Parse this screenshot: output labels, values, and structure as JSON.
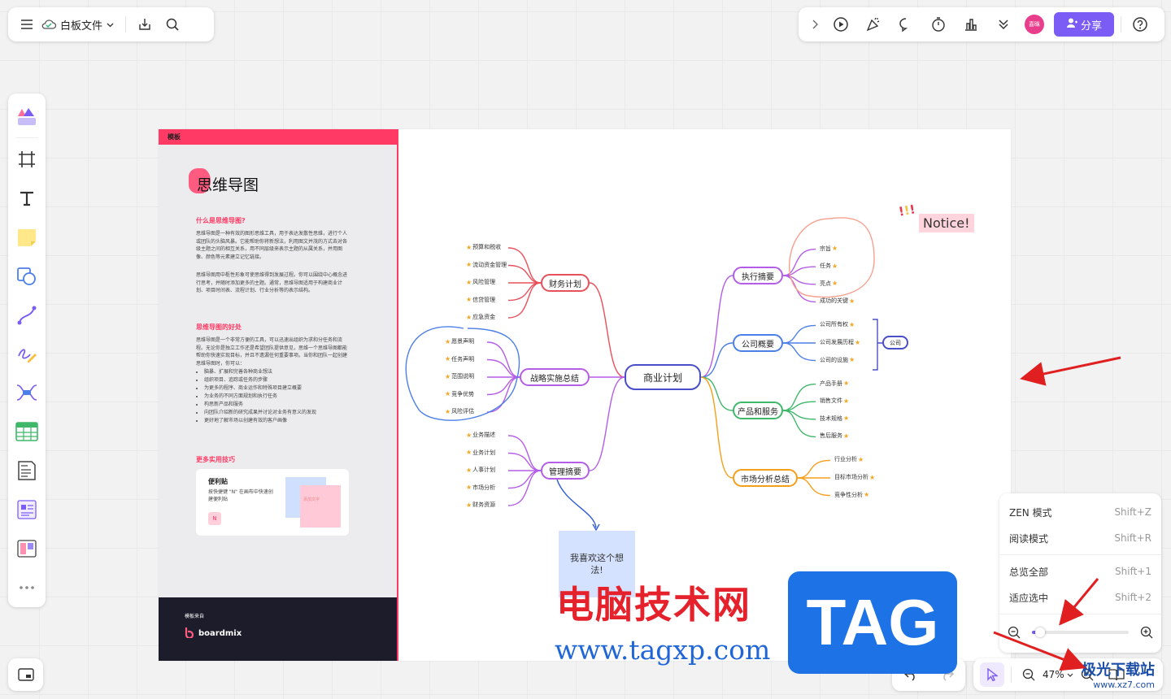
{
  "toolbar": {
    "doc_title": "白板文件",
    "avatar_label": "喜眯",
    "share_label": "分享"
  },
  "board": {
    "template_tag": "模板",
    "title": "思维导图",
    "section1_heading": "什么是思维导图?",
    "section1_text": "思维导图是一种有效的图形思维工具，用于表达发散性思维，进行个人或团队的头脑风暴。它能帮助你将新想法，利用图文并茂的方式去对各级主题之间的相互关系，用不同层级来表示主题的从属关系，并用图像、颜色等元素建立记忆链接。",
    "section1_text2": "思维导图用中枢性形象可使思维得到发展过程。你可以围绕中心概念进行思考，并随时添加更多的主题。通常，思维导图适用于构建商业计划、项目时间表、流程计划、行业分析等的表示结构。",
    "section2_heading": "思维导图的好处",
    "section2_text": "思维导图是一个非常方便的工具，可以迅速出组织为求和分任务和流程。无论你是独立工作还是希望团队提供意见，思维一个思维导图都能帮助你快速实现目标，并且不遗漏任何重要事项。当你和团队一起创建思维导图时，你可以：",
    "section2_bullets": [
      "脑暴、扩展和完善各种商业想法",
      "组织项目、追踪或任务的步骤",
      "为更多的程序、商业运作和特殊项目建立概要",
      "为业务的不同方面规划和执行任务",
      "构思新产品和服务",
      "向团队介绍新的研究成果并讨论对业务有意义的发现",
      "更好地了解市场以创建有效的客户画像"
    ],
    "section3_heading": "更多实用技巧",
    "tip_title": "便利贴",
    "tip_text": "按快捷键 \"N\" 在画布中快速创建便利贴",
    "tip_key": "N",
    "tip_note": "添加文字",
    "footer_from": "模板来自",
    "footer_brand": "boardmix",
    "center_node": "商业计划",
    "left_branches": [
      {
        "label": "财务计划",
        "leaves": [
          "预算和税收",
          "流动资金管理",
          "风险管理",
          "信贷管理",
          "应急资金"
        ]
      },
      {
        "label": "战略实施总结",
        "leaves": [
          "愿景声明",
          "任务声明",
          "范围说明",
          "竞争优势",
          "风险评估"
        ]
      },
      {
        "label": "管理摘要",
        "leaves": [
          "业务描述",
          "业务计划",
          "人事计划",
          "市场分析",
          "财务资源"
        ]
      }
    ],
    "right_branches": [
      {
        "label": "执行摘要",
        "leaves": [
          "宗旨",
          "任务",
          "亮点",
          "成功的关键"
        ]
      },
      {
        "label": "公司概要",
        "leaves": [
          "公司所有权",
          "公司发展历程",
          "公司的设施"
        ]
      },
      {
        "label": "产品和服务",
        "leaves": [
          "产品手册",
          "销售文件",
          "技术规格",
          "售后服务"
        ]
      },
      {
        "label": "市场分析总结",
        "leaves": [
          "行业分析",
          "目标市场分析",
          "竞争性分析"
        ]
      }
    ],
    "bracket_label": "公司",
    "sticky_text": "我喜欢这个想法!",
    "notice_text": "Notice!"
  },
  "view_menu": {
    "items": [
      {
        "label": "ZEN 模式",
        "shortcut": "Shift+Z"
      },
      {
        "label": "阅读模式",
        "shortcut": "Shift+R"
      },
      {
        "label": "总览全部",
        "shortcut": "Shift+1"
      },
      {
        "label": "适应选中",
        "shortcut": "Shift+2"
      }
    ],
    "zoom_fraction": 0.05
  },
  "bottom": {
    "zoom_label": "47%"
  },
  "watermarks": {
    "site_name": "电脑技术网",
    "tag": "TAG",
    "url": "www.tagxp.com",
    "corner": "极光下载站",
    "corner_url": "www.xz7.com"
  },
  "colors": {
    "accent": "#7b5cf5",
    "template_red": "#ff3b65",
    "branch_red": "#e8505b",
    "branch_purple": "#b45ee8",
    "branch_blue": "#4c7fe8",
    "branch_green": "#3fb86a",
    "branch_orange": "#f59f1a"
  }
}
